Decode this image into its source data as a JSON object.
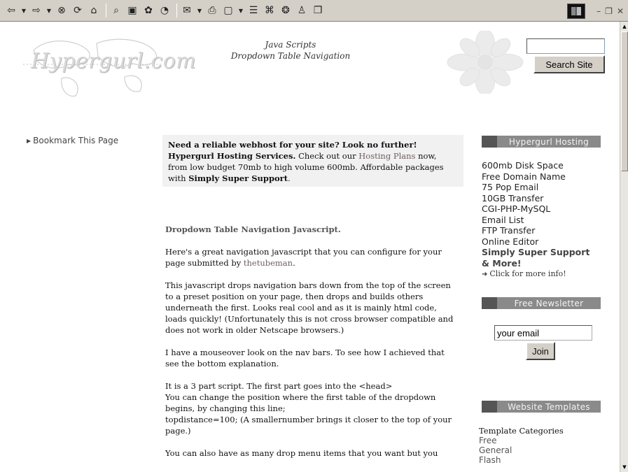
{
  "toolbar": {
    "icons": [
      "back-icon",
      "dropdown-icon",
      "forward-icon",
      "dropdown-icon",
      "stop-icon",
      "refresh-icon",
      "home-icon",
      "search-icon",
      "favorites-icon",
      "history-icon",
      "media-icon",
      "mail-icon",
      "print-icon",
      "edit-icon",
      "discuss-icon",
      "research-icon",
      "messenger-icon",
      "fullscreen-icon"
    ]
  },
  "header": {
    "logo_text": "Hypergurl.com",
    "title_line1": "Java Scripts",
    "title_line2": "Dropdown Table Navigation",
    "search_button": "Search Site",
    "search_value": ""
  },
  "left": {
    "bookmark_label": "Bookmark This Page"
  },
  "ad": {
    "headline": "Need a reliable webhost for your site? Look no further!",
    "brand": "Hypergurl Hosting Services.",
    "text1": " Check out our ",
    "plans_link": "Hosting Plans",
    "text2": " now, from low budget 70mb to high volume 600mb. Affordable packages with ",
    "support": "Simply Super Support",
    "end": "."
  },
  "main": {
    "heading": "Dropdown Table Navigation Javascript.",
    "p1_text": "Here's a great navigation javascript that you can configure for your page submitted by ",
    "p1_link": "thetubeman",
    "p1_end": ".",
    "p2": "This javascript drops navigation bars down from the top of the screen to a preset position on your page, then drops and builds others underneath the first. Looks real cool and as it is mainly html code, loads quickly! (Unfortunately this is not cross browser compatible and does not work in older Netscape browsers.)",
    "p3": "I have a mouseover look on the nav bars. To see how I achieved that see the bottom explanation.",
    "p4_line1": "It is a 3 part script. The first part goes into the <head>",
    "p4_line2": "You can change the position where the first table of the dropdown begins, by changing this line;",
    "p4_line3": "topdistance=100; (A smallernumber brings it closer to the top of your page.)",
    "p5": "You can also have as many drop menu items that you want but you"
  },
  "sidebar": {
    "hosting_title": "Hypergurl Hosting",
    "hosting_items": [
      "600mb Disk Space",
      "Free Domain Name",
      "75 Pop Email",
      "10GB Transfer",
      "CGI-PHP-MySQL",
      "Email List",
      "FTP Transfer",
      "Online Editor"
    ],
    "support_line1": "Simply Super Support",
    "support_line2": "& More!",
    "more_info": "Click for more info!",
    "newsletter_title": "Free Newsletter",
    "email_value": "your email",
    "join_label": "Join",
    "templates_title": "Website Templates",
    "templates_label": "Template Categories",
    "template_cats": [
      "Free",
      "General",
      "Flash"
    ]
  }
}
